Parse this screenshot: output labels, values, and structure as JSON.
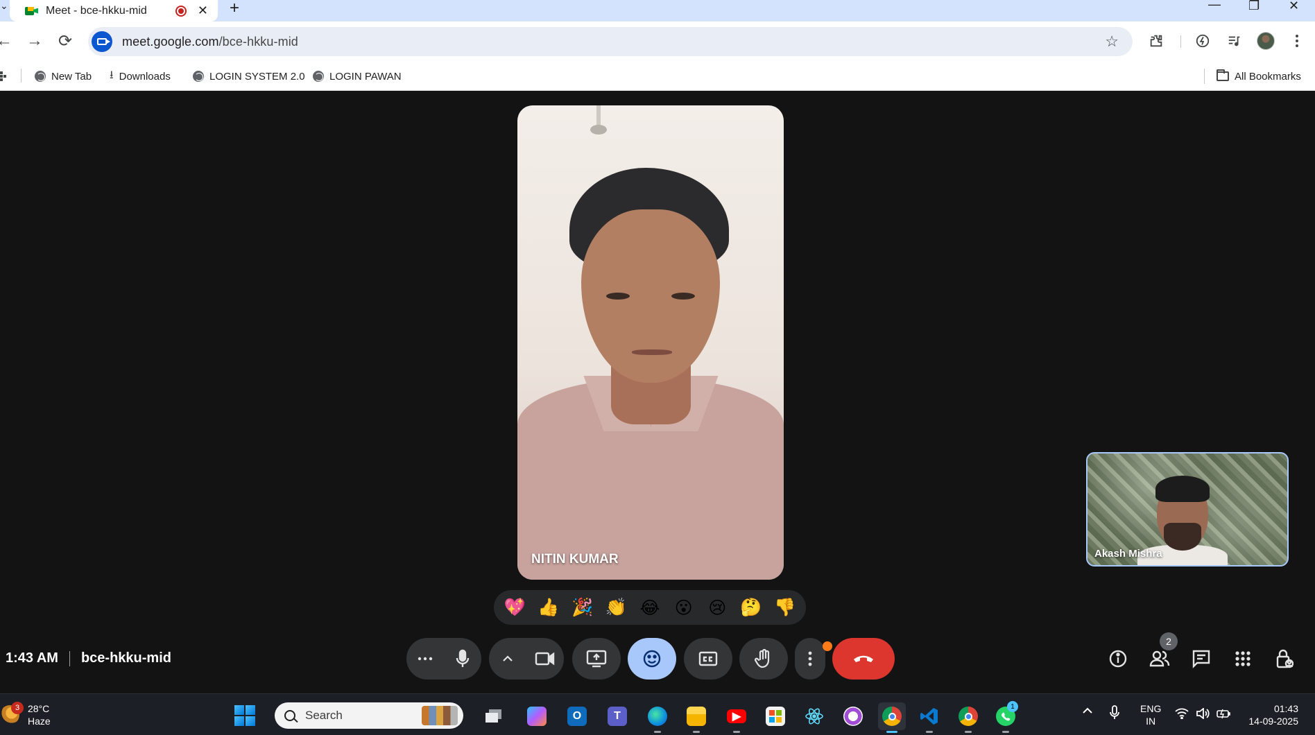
{
  "browser": {
    "tab": {
      "title": "Meet - bce-hkku-mid",
      "close_glyph": "✕"
    },
    "new_tab_glyph": "+",
    "window_controls": [
      "—",
      "❐",
      "✕"
    ],
    "nav": {
      "back": "←",
      "forward": "→",
      "reload": "⟳"
    },
    "url": {
      "host": "meet.google.com",
      "path": "/bce-hkku-mid"
    },
    "bookmark_star": "☆",
    "bookmarks": [
      {
        "label": "New Tab",
        "icon": "globe-icon"
      },
      {
        "label": "Downloads",
        "icon": "download-icon"
      },
      {
        "label": "LOGIN SYSTEM 2.0",
        "icon": "globe-icon"
      },
      {
        "label": "LOGIN PAWAN",
        "icon": "globe-icon"
      }
    ],
    "all_bookmarks": "All Bookmarks"
  },
  "meet": {
    "main_participant": "NITIN KUMAR",
    "self_participant": "Akash Mishra",
    "time": "1:43 AM",
    "meeting_code": "bce-hkku-mid",
    "reactions": [
      "💖",
      "👍",
      "🎉",
      "👏",
      "😂",
      "😮",
      "😢",
      "🤔",
      "👎"
    ],
    "people_count": "2",
    "colors": {
      "end_call": "#dc362e",
      "active": "#a8c7fa",
      "stage": "#131314"
    }
  },
  "taskbar": {
    "weather": {
      "temp": "28°C",
      "condition": "Haze",
      "badge": "3"
    },
    "search_placeholder": "Search",
    "whatsapp_badge": "1",
    "tray_chevron": "^",
    "language": {
      "line1": "ENG",
      "line2": "IN"
    },
    "clock": {
      "time": "01:43",
      "date": "14-09-2025"
    }
  }
}
